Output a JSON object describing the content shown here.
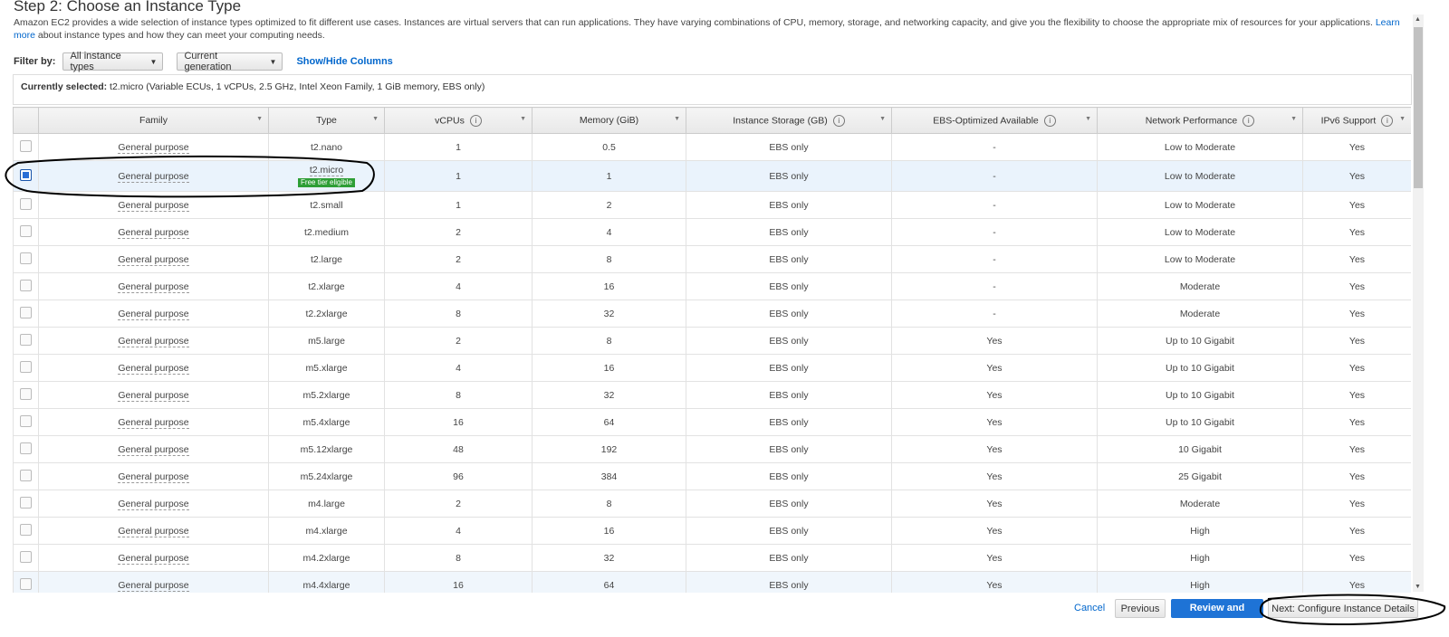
{
  "page": {
    "title": "Step 2: Choose an Instance Type",
    "description": "Amazon EC2 provides a wide selection of instance types optimized to fit different use cases. Instances are virtual servers that can run applications. They have varying combinations of CPU, memory, storage, and networking capacity, and give you the flexibility to choose the appropriate mix of resources for your applications.",
    "learn_more": "Learn more",
    "description_tail": "about instance types and how they can meet your computing needs."
  },
  "filter": {
    "label": "Filter by:",
    "type_value": "All instance types",
    "generation_value": "Current generation",
    "show_hide": "Show/Hide Columns"
  },
  "current": {
    "label": "Currently selected:",
    "value": "t2.micro (Variable ECUs, 1 vCPUs, 2.5 GHz, Intel Xeon Family, 1 GiB memory, EBS only)"
  },
  "table": {
    "headers": [
      "Family",
      "Type",
      "vCPUs",
      "Memory (GiB)",
      "Instance Storage (GB)",
      "EBS-Optimized Available",
      "Network Performance",
      "IPv6 Support"
    ],
    "free_tier_label": "Free tier eligible",
    "rows": [
      {
        "family": "General purpose",
        "type": "t2.nano",
        "vcpus": "1",
        "memory": "0.5",
        "storage": "EBS only",
        "ebs": "-",
        "network": "Low to Moderate",
        "ipv6": "Yes",
        "selected": false
      },
      {
        "family": "General purpose",
        "type": "t2.micro",
        "vcpus": "1",
        "memory": "1",
        "storage": "EBS only",
        "ebs": "-",
        "network": "Low to Moderate",
        "ipv6": "Yes",
        "selected": true,
        "free": true
      },
      {
        "family": "General purpose",
        "type": "t2.small",
        "vcpus": "1",
        "memory": "2",
        "storage": "EBS only",
        "ebs": "-",
        "network": "Low to Moderate",
        "ipv6": "Yes",
        "selected": false
      },
      {
        "family": "General purpose",
        "type": "t2.medium",
        "vcpus": "2",
        "memory": "4",
        "storage": "EBS only",
        "ebs": "-",
        "network": "Low to Moderate",
        "ipv6": "Yes",
        "selected": false
      },
      {
        "family": "General purpose",
        "type": "t2.large",
        "vcpus": "2",
        "memory": "8",
        "storage": "EBS only",
        "ebs": "-",
        "network": "Low to Moderate",
        "ipv6": "Yes",
        "selected": false
      },
      {
        "family": "General purpose",
        "type": "t2.xlarge",
        "vcpus": "4",
        "memory": "16",
        "storage": "EBS only",
        "ebs": "-",
        "network": "Moderate",
        "ipv6": "Yes",
        "selected": false
      },
      {
        "family": "General purpose",
        "type": "t2.2xlarge",
        "vcpus": "8",
        "memory": "32",
        "storage": "EBS only",
        "ebs": "-",
        "network": "Moderate",
        "ipv6": "Yes",
        "selected": false
      },
      {
        "family": "General purpose",
        "type": "m5.large",
        "vcpus": "2",
        "memory": "8",
        "storage": "EBS only",
        "ebs": "Yes",
        "network": "Up to 10 Gigabit",
        "ipv6": "Yes",
        "selected": false
      },
      {
        "family": "General purpose",
        "type": "m5.xlarge",
        "vcpus": "4",
        "memory": "16",
        "storage": "EBS only",
        "ebs": "Yes",
        "network": "Up to 10 Gigabit",
        "ipv6": "Yes",
        "selected": false
      },
      {
        "family": "General purpose",
        "type": "m5.2xlarge",
        "vcpus": "8",
        "memory": "32",
        "storage": "EBS only",
        "ebs": "Yes",
        "network": "Up to 10 Gigabit",
        "ipv6": "Yes",
        "selected": false
      },
      {
        "family": "General purpose",
        "type": "m5.4xlarge",
        "vcpus": "16",
        "memory": "64",
        "storage": "EBS only",
        "ebs": "Yes",
        "network": "Up to 10 Gigabit",
        "ipv6": "Yes",
        "selected": false
      },
      {
        "family": "General purpose",
        "type": "m5.12xlarge",
        "vcpus": "48",
        "memory": "192",
        "storage": "EBS only",
        "ebs": "Yes",
        "network": "10 Gigabit",
        "ipv6": "Yes",
        "selected": false
      },
      {
        "family": "General purpose",
        "type": "m5.24xlarge",
        "vcpus": "96",
        "memory": "384",
        "storage": "EBS only",
        "ebs": "Yes",
        "network": "25 Gigabit",
        "ipv6": "Yes",
        "selected": false
      },
      {
        "family": "General purpose",
        "type": "m4.large",
        "vcpus": "2",
        "memory": "8",
        "storage": "EBS only",
        "ebs": "Yes",
        "network": "Moderate",
        "ipv6": "Yes",
        "selected": false
      },
      {
        "family": "General purpose",
        "type": "m4.xlarge",
        "vcpus": "4",
        "memory": "16",
        "storage": "EBS only",
        "ebs": "Yes",
        "network": "High",
        "ipv6": "Yes",
        "selected": false
      },
      {
        "family": "General purpose",
        "type": "m4.2xlarge",
        "vcpus": "8",
        "memory": "32",
        "storage": "EBS only",
        "ebs": "Yes",
        "network": "High",
        "ipv6": "Yes",
        "selected": false
      },
      {
        "family": "General purpose",
        "type": "m4.4xlarge",
        "vcpus": "16",
        "memory": "64",
        "storage": "EBS only",
        "ebs": "Yes",
        "network": "High",
        "ipv6": "Yes",
        "selected": false
      }
    ]
  },
  "footer": {
    "cancel": "Cancel",
    "previous": "Previous",
    "review": "Review and Launch",
    "next": "Next: Configure Instance Details"
  },
  "colors": {
    "primary_button": "#1e73d6",
    "link": "#0066cc",
    "free_tier_badge": "#2e9e36",
    "selected_row": "#eaf3fc"
  }
}
